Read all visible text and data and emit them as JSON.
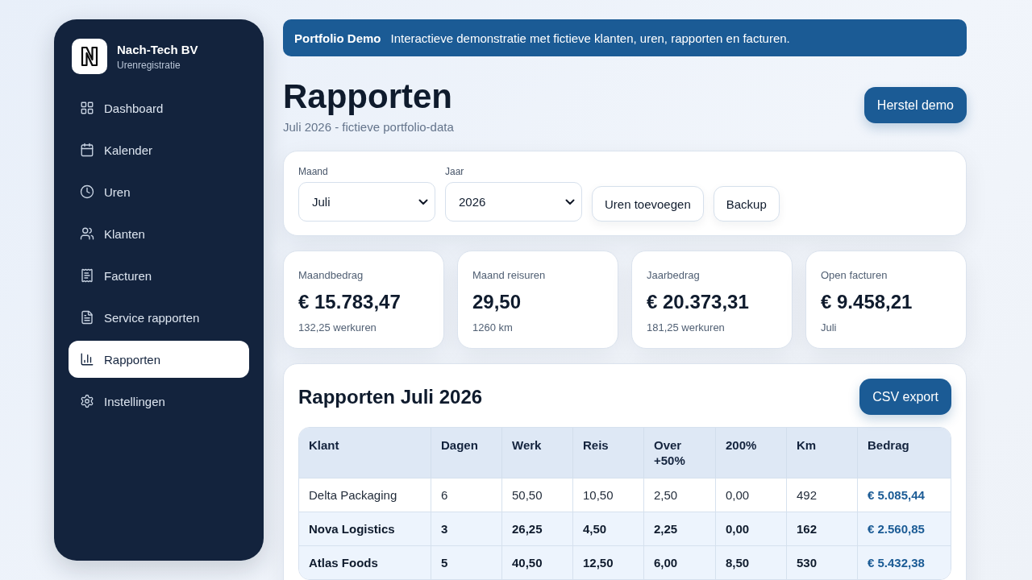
{
  "sidebar": {
    "brand": {
      "name": "Nach-Tech BV",
      "subtitle": "Urenregistratie"
    },
    "items": [
      {
        "label": "Dashboard",
        "selected": false
      },
      {
        "label": "Kalender",
        "selected": false
      },
      {
        "label": "Uren",
        "selected": false
      },
      {
        "label": "Klanten",
        "selected": false
      },
      {
        "label": "Facturen",
        "selected": false
      },
      {
        "label": "Service rapporten",
        "selected": false
      },
      {
        "label": "Rapporten",
        "selected": true
      },
      {
        "label": "Instellingen",
        "selected": false
      }
    ]
  },
  "banner": {
    "title": "Portfolio Demo",
    "text": "Interactieve demonstratie met fictieve klanten, uren, rapporten en facturen."
  },
  "header": {
    "title": "Rapporten",
    "subtitle": "Juli 2026 - fictieve portfolio-data",
    "button": "Herstel demo"
  },
  "filters": {
    "fields": [
      {
        "label": "Maand",
        "value": "Juli"
      },
      {
        "label": "Jaar",
        "value": "2026"
      }
    ],
    "buttons": [
      "Uren toevoegen",
      "Backup"
    ]
  },
  "stats": [
    {
      "label": "Maandbedrag",
      "value": "€ 15.783,47",
      "note": "132,25 werkuren"
    },
    {
      "label": "Maand reisuren",
      "value": "29,50",
      "note": "1260 km"
    },
    {
      "label": "Jaarbedrag",
      "value": "€ 20.373,31",
      "note": "181,25 werkuren"
    },
    {
      "label": "Open facturen",
      "value": "€ 9.458,21",
      "note": "Juli"
    }
  ],
  "report": {
    "title": "Rapporten Juli 2026",
    "export_button": "CSV export",
    "table": {
      "columns": [
        "Klant",
        "Dagen",
        "Werk",
        "Reis",
        "Over +50%",
        "200%",
        "Km",
        "Bedrag"
      ],
      "rows": [
        {
          "highlighted": false,
          "cells": [
            "Delta Packaging",
            "6",
            "50,50",
            "10,50",
            "2,50",
            "0,00",
            "492",
            "€ 5.085,44"
          ]
        },
        {
          "highlighted": true,
          "cells": [
            "Nova Logistics",
            "3",
            "26,25",
            "4,50",
            "2,25",
            "0,00",
            "162",
            "€ 2.560,85"
          ]
        },
        {
          "highlighted": true,
          "cells": [
            "Atlas Foods",
            "5",
            "40,50",
            "12,50",
            "6,00",
            "8,50",
            "530",
            "€ 5.432,38"
          ]
        }
      ]
    }
  }
}
